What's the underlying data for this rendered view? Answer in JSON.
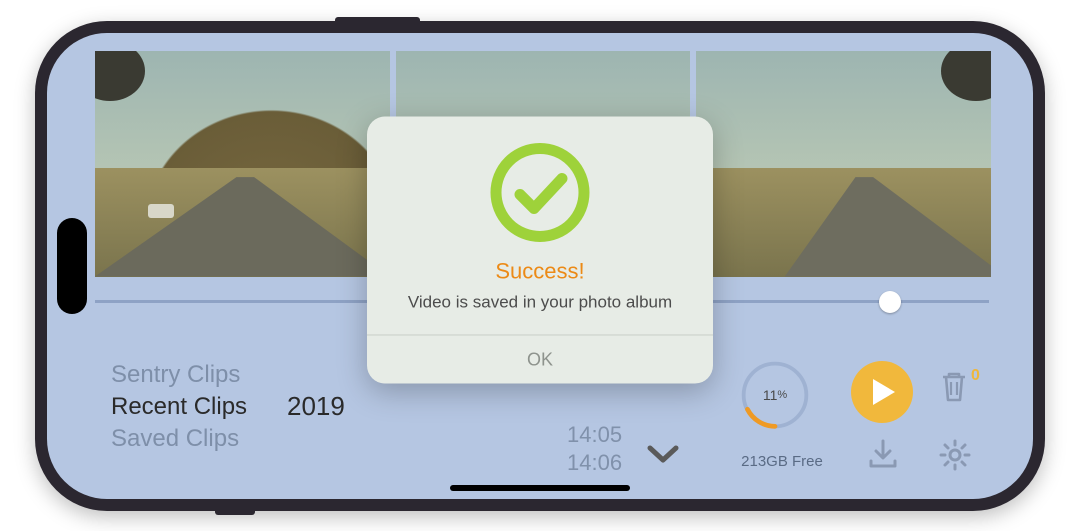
{
  "modal": {
    "title": "Success!",
    "message": "Video is saved in your photo album",
    "ok_label": "OK"
  },
  "clips": {
    "sentry": "Sentry Clips",
    "recent": "Recent Clips",
    "saved": "Saved Clips"
  },
  "date": "2019",
  "times": {
    "t1": "14:05",
    "t2": "14:06"
  },
  "storage": {
    "percent": "11",
    "percent_suffix": "%",
    "free": "213GB Free"
  },
  "trash_count": "0",
  "colors": {
    "accent_green": "#9ed23a",
    "accent_orange": "#ec8a16",
    "play_yellow": "#f1b83c"
  }
}
